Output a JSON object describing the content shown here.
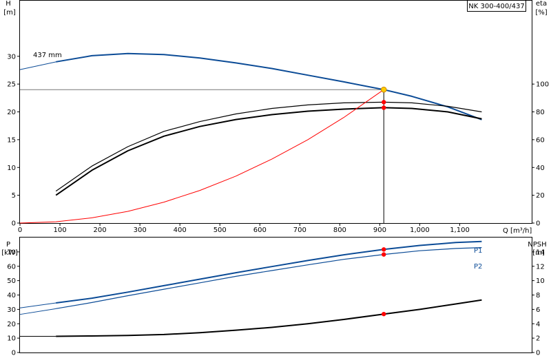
{
  "chart_data": [
    {
      "type": "line",
      "title": "NK 300-400/437",
      "xlabel": "Q [m³/h]",
      "x_ticks": [
        "0",
        "100",
        "200",
        "300",
        "400",
        "500",
        "600",
        "700",
        "800",
        "900",
        "1,000",
        "1,100"
      ],
      "xlim": [
        0,
        1280
      ],
      "left_axis": {
        "label_top": "H",
        "label_unit": "[m]",
        "ylim": [
          0,
          40
        ],
        "ticks": [
          "0",
          "5",
          "10",
          "15",
          "20",
          "25",
          "30"
        ]
      },
      "right_axis": {
        "label_top": "eta",
        "label_unit": "[%]",
        "ylim": [
          0,
          160
        ],
        "ticks": [
          "0",
          "20",
          "40",
          "60",
          "80",
          "100"
        ]
      },
      "series": [
        {
          "name": "437 mm",
          "axis": "left",
          "color": "#0b4b96",
          "x": [
            90,
            180,
            270,
            360,
            450,
            540,
            630,
            720,
            810,
            910,
            980,
            1070,
            1155
          ],
          "y": [
            29.0,
            30.1,
            30.5,
            30.3,
            29.7,
            28.8,
            27.8,
            26.6,
            25.4,
            24.0,
            22.8,
            20.9,
            18.6
          ]
        },
        {
          "axis": "right",
          "color": "#000000",
          "x": [
            90,
            180,
            270,
            360,
            450,
            540,
            630,
            720,
            810,
            910,
            980,
            1070,
            1155
          ],
          "y": [
            23,
            41,
            55,
            66,
            73,
            78.5,
            82.5,
            85,
            86.5,
            87,
            86.5,
            84,
            80
          ]
        },
        {
          "axis": "right",
          "color": "#000000",
          "x": [
            90,
            180,
            270,
            360,
            450,
            540,
            630,
            720,
            810,
            910,
            980,
            1070,
            1155
          ],
          "y": [
            20,
            38,
            52,
            62.5,
            69.5,
            74.5,
            78,
            80.5,
            82,
            83,
            82.5,
            80,
            75
          ]
        },
        {
          "axis": "left",
          "color": "#ff0000",
          "x": [
            0,
            90,
            180,
            270,
            360,
            450,
            540,
            630,
            720,
            810,
            910
          ],
          "y": [
            0,
            0.23,
            0.94,
            2.1,
            3.76,
            5.87,
            8.45,
            11.5,
            15.0,
            19.0,
            24.0
          ]
        }
      ],
      "reference_line": {
        "axis": "left",
        "y": 24.0
      },
      "duty_point": {
        "x": 910,
        "h": 24.0,
        "eta_points": [
          87,
          83
        ]
      }
    },
    {
      "type": "line",
      "xlim": [
        0,
        1280
      ],
      "left_axis": {
        "label_top": "P",
        "label_unit": "[kW]",
        "ylim": [
          0,
          80
        ],
        "ticks": [
          "0",
          "10",
          "20",
          "30",
          "40",
          "50",
          "60",
          "70"
        ]
      },
      "right_axis": {
        "label_top": "NPSH",
        "label_unit": "[m]",
        "ylim": [
          0,
          16
        ],
        "ticks": [
          "0",
          "2",
          "4",
          "6",
          "8",
          "10",
          "12",
          "14"
        ]
      },
      "series": [
        {
          "name": "P1",
          "axis": "left",
          "color": "#0b4b96",
          "x": [
            90,
            180,
            270,
            360,
            450,
            540,
            630,
            720,
            810,
            910,
            1000,
            1090,
            1155
          ],
          "y": [
            34.5,
            37.8,
            42.0,
            46.5,
            51.0,
            55.5,
            59.8,
            64.0,
            68.0,
            71.7,
            74.5,
            76.5,
            77.2
          ]
        },
        {
          "name": "P2",
          "axis": "left",
          "color": "#0b4b96",
          "x": [
            90,
            180,
            270,
            360,
            450,
            540,
            630,
            720,
            810,
            910,
            1000,
            1090,
            1155
          ],
          "y": [
            30.5,
            34.8,
            39.5,
            44.0,
            48.5,
            53.0,
            57.0,
            61.0,
            64.8,
            68.2,
            70.8,
            72.4,
            73.0
          ]
        },
        {
          "axis": "right",
          "color": "#000000",
          "x": [
            90,
            180,
            270,
            360,
            450,
            540,
            630,
            720,
            810,
            910,
            1000,
            1090,
            1155
          ],
          "y": [
            2.25,
            2.3,
            2.38,
            2.5,
            2.75,
            3.1,
            3.5,
            4.0,
            4.6,
            5.35,
            6.0,
            6.75,
            7.3
          ]
        }
      ],
      "duty_point": {
        "x": 910,
        "p1": 71.7,
        "p2": 68.2,
        "npsh": 5.35
      }
    }
  ]
}
